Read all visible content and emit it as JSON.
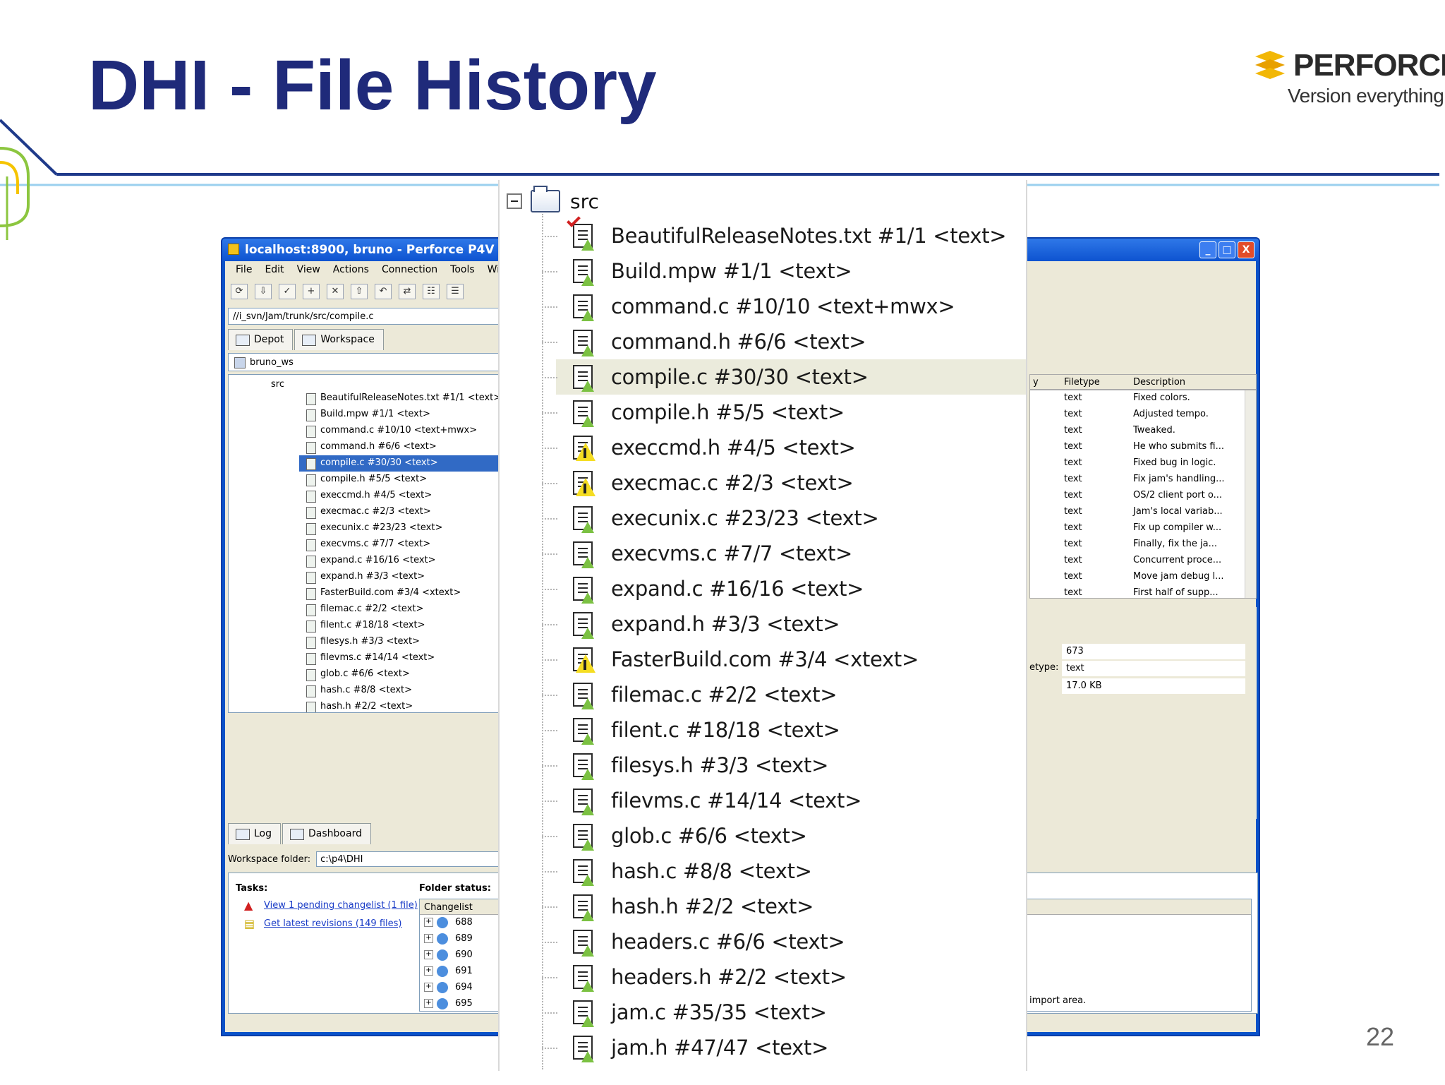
{
  "slide": {
    "title": "DHI - File History",
    "logo_word": "PERFORCE",
    "logo_tagline": "Version everything.",
    "page_number": "22"
  },
  "window": {
    "title": "localhost:8900, bruno - Perforce P4V",
    "controls": [
      "_",
      "□",
      "X"
    ],
    "menu": [
      "File",
      "Edit",
      "View",
      "Actions",
      "Connection",
      "Tools",
      "Windo"
    ],
    "path": "//i_svn/Jam/trunk/src/compile.c",
    "tabs": [
      "Depot",
      "Workspace"
    ],
    "workspace_name": "bruno_ws",
    "tree_root": "src",
    "tree_items": [
      "BeautifulReleaseNotes.txt #1/1 <text>",
      "Build.mpw #1/1 <text>",
      "command.c #10/10 <text+mwx>",
      "command.h #6/6 <text>",
      "compile.c #30/30 <text>",
      "compile.h #5/5 <text>",
      "execcmd.h #4/5 <text>",
      "execmac.c #2/3 <text>",
      "execunix.c #23/23 <text>",
      "execvms.c #7/7 <text>",
      "expand.c #16/16 <text>",
      "expand.h #3/3 <text>",
      "FasterBuild.com #3/4 <xtext>",
      "filemac.c #2/2 <text>",
      "filent.c #18/18 <text>",
      "filesys.h #3/3 <text>",
      "filevms.c #14/14 <text>",
      "glob.c #6/6 <text>",
      "hash.c #8/8 <text>",
      "hash.h #2/2 <text>",
      "headers.c #6/6 <text>",
      "headers.h #2/2 <text>",
      "jam.c #35/35 <text>",
      "jam.h #47/47 <text>"
    ],
    "bottom_tabs": [
      "Log",
      "Dashboard"
    ],
    "workspace_folder_label": "Workspace folder:",
    "workspace_folder_value": "c:\\p4\\DHI",
    "tasks_label": "Tasks:",
    "task_links": [
      "View 1 pending changelist (1 file)",
      "Get latest revisions (149 files)"
    ],
    "folder_status_label": "Folder status:",
    "changelist_header": "Changelist",
    "changelists": [
      "688",
      "689",
      "690",
      "691",
      "694",
      "695"
    ],
    "history_columns": [
      "y",
      "Filetype",
      "Description"
    ],
    "history_rows": [
      {
        "filetype": "text",
        "description": "Fixed colors."
      },
      {
        "filetype": "text",
        "description": "Adjusted tempo."
      },
      {
        "filetype": "text",
        "description": "Tweaked."
      },
      {
        "filetype": "text",
        "description": "He who submits fi..."
      },
      {
        "filetype": "text",
        "description": "Fixed bug in logic."
      },
      {
        "filetype": "text",
        "description": "Fix jam's handling..."
      },
      {
        "filetype": "text",
        "description": "OS/2 client port o..."
      },
      {
        "filetype": "text",
        "description": "Jam's local variab..."
      },
      {
        "filetype": "text",
        "description": "Fix up compiler w..."
      },
      {
        "filetype": "text",
        "description": "Finally, fix the ja..."
      },
      {
        "filetype": "text",
        "description": "Concurrent proce..."
      },
      {
        "filetype": "text",
        "description": "Move jam debug l..."
      },
      {
        "filetype": "text",
        "description": "First half of supp..."
      }
    ],
    "details": {
      "size_value": "673",
      "filetype_label": "etype:",
      "filetype_value": "text",
      "filesize_value": "17.0 KB"
    },
    "import_note": "import area."
  },
  "zoom": {
    "root": "src",
    "items": [
      {
        "label": "BeautifulReleaseNotes.txt #1/1 <text>",
        "icon": "file-checked-out-icon"
      },
      {
        "label": "Build.mpw #1/1 <text>",
        "icon": "file-icon"
      },
      {
        "label": "command.c #10/10 <text+mwx>",
        "icon": "file-icon"
      },
      {
        "label": "command.h #6/6 <text>",
        "icon": "file-icon"
      },
      {
        "label": "compile.c #30/30 <text>",
        "icon": "file-icon",
        "selected": true
      },
      {
        "label": "compile.h #5/5 <text>",
        "icon": "file-icon"
      },
      {
        "label": "execcmd.h #4/5 <text>",
        "icon": "file-out-of-date-icon"
      },
      {
        "label": "execmac.c #2/3 <text>",
        "icon": "file-out-of-date-icon"
      },
      {
        "label": "execunix.c #23/23 <text>",
        "icon": "file-icon"
      },
      {
        "label": "execvms.c #7/7 <text>",
        "icon": "file-icon"
      },
      {
        "label": "expand.c #16/16 <text>",
        "icon": "file-icon"
      },
      {
        "label": "expand.h #3/3 <text>",
        "icon": "file-icon"
      },
      {
        "label": "FasterBuild.com #3/4 <xtext>",
        "icon": "file-out-of-date-icon"
      },
      {
        "label": "filemac.c #2/2 <text>",
        "icon": "file-icon"
      },
      {
        "label": "filent.c #18/18 <text>",
        "icon": "file-icon"
      },
      {
        "label": "filesys.h #3/3 <text>",
        "icon": "file-icon"
      },
      {
        "label": "filevms.c #14/14 <text>",
        "icon": "file-icon"
      },
      {
        "label": "glob.c #6/6 <text>",
        "icon": "file-icon"
      },
      {
        "label": "hash.c #8/8 <text>",
        "icon": "file-icon"
      },
      {
        "label": "hash.h #2/2 <text>",
        "icon": "file-icon"
      },
      {
        "label": "headers.c #6/6 <text>",
        "icon": "file-icon"
      },
      {
        "label": "headers.h #2/2 <text>",
        "icon": "file-icon"
      },
      {
        "label": "jam.c #35/35 <text>",
        "icon": "file-icon"
      },
      {
        "label": "jam.h #47/47 <text>",
        "icon": "file-icon"
      }
    ]
  },
  "colors": {
    "title": "#1f2a7a",
    "accent_green": "#7bc142",
    "warn_yellow": "#f5dd22",
    "selection": "#316ac5"
  }
}
